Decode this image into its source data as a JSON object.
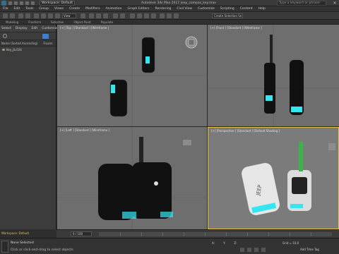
{
  "titlebar": {
    "workspace": "Workspace: Default",
    "title": "Autodesk 3ds Max 2017    jeep_compas_key.max",
    "search_placeholder": "Type a keyword or phrase"
  },
  "menu": [
    "File",
    "Edit",
    "Tools",
    "Group",
    "Views",
    "Create",
    "Modifiers",
    "Animation",
    "Graph Editors",
    "Rendering",
    "Civil View",
    "Customize",
    "Scripting",
    "Content",
    "Help"
  ],
  "toolbar": {
    "view_select": "View",
    "selection_set": "Create Selection Se"
  },
  "ribbon": [
    "Modeling",
    "Freeform",
    "Selection",
    "Object Paint",
    "Populate"
  ],
  "explorer": {
    "menu": [
      "Select",
      "Display",
      "Edit",
      "Customize"
    ],
    "header": [
      "Name (Sorted Ascending)",
      "Frozen"
    ],
    "rows": [
      "Key_jb.024"
    ]
  },
  "viewports": {
    "top": "[+] [Top ] [Standard ] [Wireframe ]",
    "front": "[+] [Front ] [Standard ] [Wireframe ]",
    "left": "[+] [Left ] [Standard ] [Wireframe ]",
    "perspective": "[+] [Perspective ] [Standard ] [Default Shading ]"
  },
  "timeline": {
    "frame": "0 / 100"
  },
  "workspace_bar": "Workspace: Default",
  "status": {
    "line1": "None Selected",
    "line2": "Click or click-and-drag to select objects",
    "x": "X:",
    "y": "Y:",
    "z": "Z:",
    "grid": "Grid = 10,0",
    "time_tag": "Add Time Tag"
  },
  "colors": {
    "accent_cyan": "#35e6f0",
    "active_border": "#e8c23a"
  }
}
